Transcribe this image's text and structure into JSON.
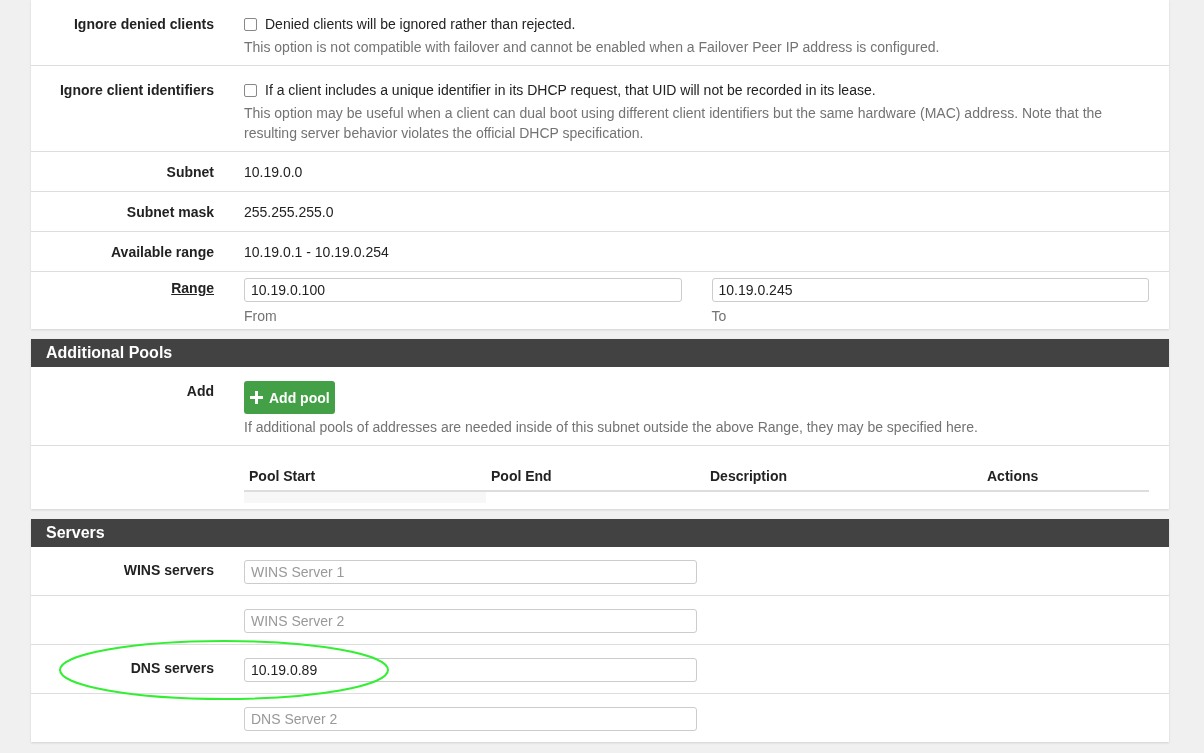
{
  "sections": [
    {
      "rows": [
        {
          "kind": "checkbox",
          "label": "Ignore denied clients",
          "checked": false,
          "text": "Denied clients will be ignored rather than rejected.",
          "help": "This option is not compatible with failover and cannot be enabled when a Failover Peer IP address is configured."
        },
        {
          "kind": "checkbox",
          "label": "Ignore client identifiers",
          "checked": false,
          "text": "If a client includes a unique identifier in its DHCP request, that UID will not be recorded in its lease.",
          "help": "This option may be useful when a client can dual boot using different client identifiers but the same hardware (MAC) address. Note that the resulting server behavior violates the official DHCP specification."
        },
        {
          "kind": "static",
          "label": "Subnet",
          "text": "10.19.0.0"
        },
        {
          "kind": "static",
          "label": "Subnet mask",
          "text": "255.255.255.0"
        },
        {
          "kind": "static",
          "label": "Available range",
          "text": "10.19.0.1 - 10.19.0.254"
        },
        {
          "kind": "range",
          "label": "Range",
          "from": {
            "value": "10.19.0.100",
            "caption": "From"
          },
          "to": {
            "value": "10.19.0.245",
            "caption": "To"
          }
        }
      ]
    },
    {
      "title": "Additional Pools",
      "rows": [
        {
          "kind": "button",
          "label": "Add",
          "button": "Add pool",
          "help": "If additional pools of addresses are needed inside of this subnet outside the above Range, they may be specified here."
        },
        {
          "kind": "table",
          "columns": [
            "Pool Start",
            "Pool End",
            "Description",
            "Actions"
          ]
        }
      ]
    },
    {
      "title": "Servers",
      "rows": [
        {
          "kind": "input",
          "label": "WINS servers",
          "placeholder": "WINS Server 1",
          "highlighted": false
        },
        {
          "kind": "input",
          "placeholder": "WINS Server 2",
          "highlighted": false
        },
        {
          "kind": "input",
          "label": "DNS servers",
          "value": "10.19.0.89",
          "highlighted": true
        },
        {
          "kind": "input",
          "placeholder": "DNS Server 2",
          "highlighted": false
        }
      ]
    }
  ]
}
